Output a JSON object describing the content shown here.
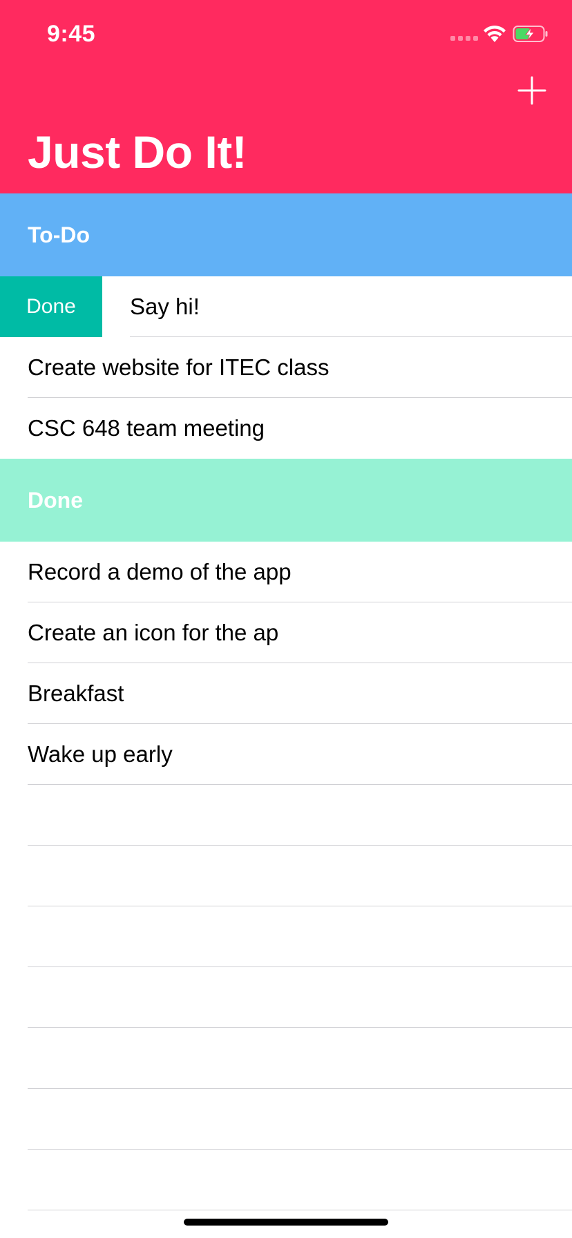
{
  "status_bar": {
    "time": "9:45",
    "icons": [
      "signal-icon",
      "wifi-icon",
      "battery-charging-icon"
    ]
  },
  "nav": {
    "title": "Just Do It!",
    "add_icon": "plus-icon"
  },
  "colors": {
    "header": "#FF2A5F",
    "todo_section": "#61B1F6",
    "done_section": "#96F2D4",
    "swipe_action": "#00BBA5"
  },
  "sections": {
    "todo": {
      "title": "To-Do",
      "items": [
        {
          "label": "Say hi!",
          "swipe_action": "Done"
        },
        {
          "label": "Create website for ITEC class"
        },
        {
          "label": "CSC 648 team meeting"
        }
      ]
    },
    "done": {
      "title": "Done",
      "items": [
        {
          "label": "Record a demo of the app"
        },
        {
          "label": "Create an icon for the ap"
        },
        {
          "label": "Breakfast"
        },
        {
          "label": "Wake up early"
        }
      ]
    }
  }
}
